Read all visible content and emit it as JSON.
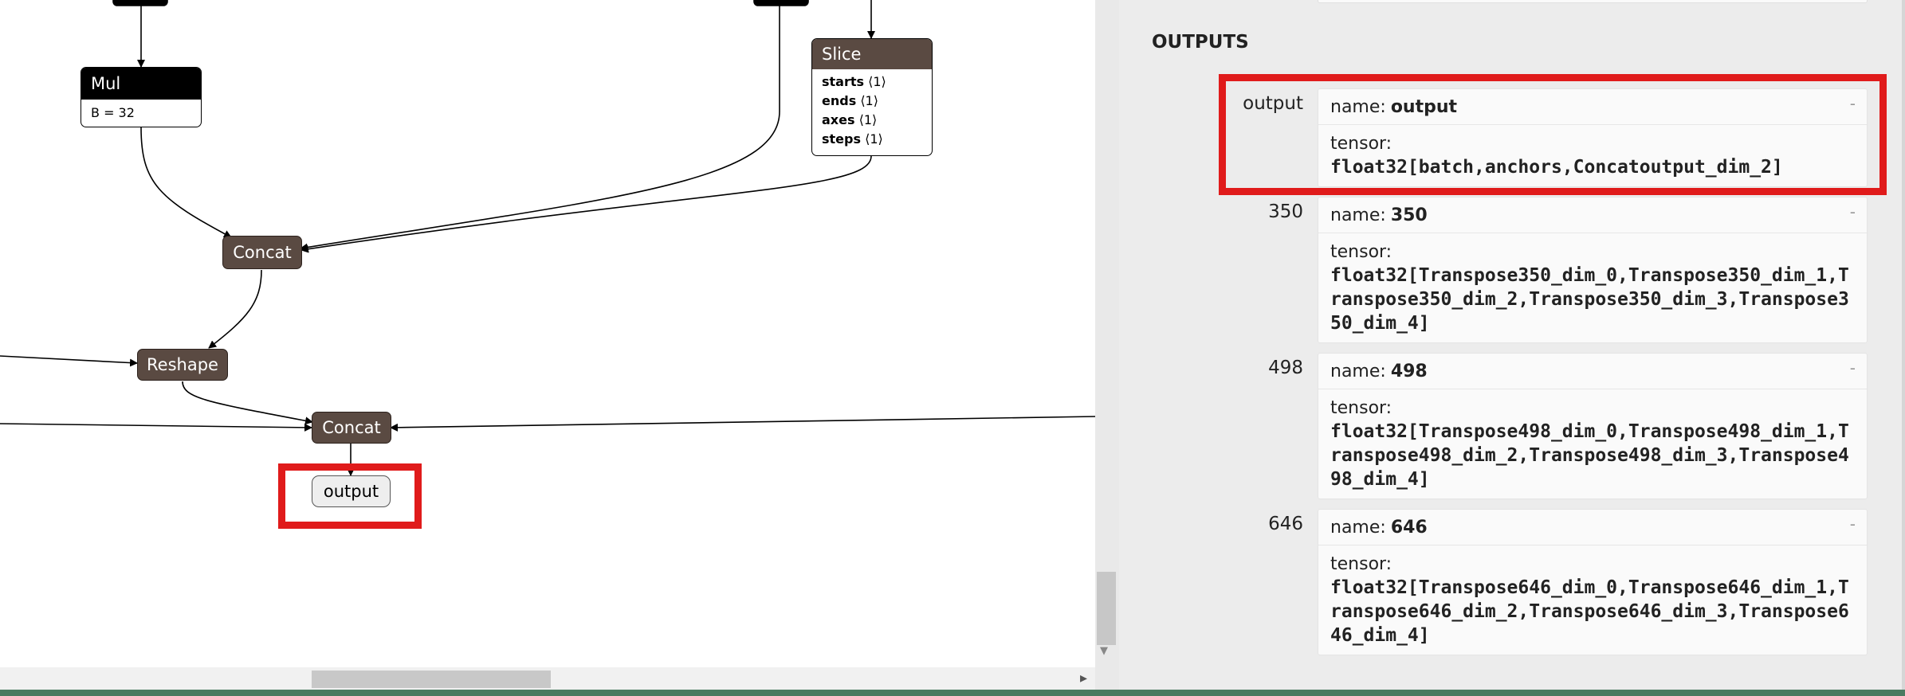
{
  "graph": {
    "nodes": {
      "mul": {
        "title": "Mul",
        "attr": "B = 32"
      },
      "slice": {
        "title": "Slice",
        "attrs": [
          {
            "key": "starts",
            "value": "⟨1⟩"
          },
          {
            "key": "ends",
            "value": "⟨1⟩"
          },
          {
            "key": "axes",
            "value": "⟨1⟩"
          },
          {
            "key": "steps",
            "value": "⟨1⟩"
          }
        ]
      },
      "concat1": "Concat",
      "reshape": "Reshape",
      "concat2": "Concat",
      "output": "output"
    }
  },
  "sidebar": {
    "section_title": "OUTPUTS",
    "outputs": [
      {
        "label": "output",
        "name_label": "name:",
        "name": "output",
        "tensor_label": "tensor:",
        "type": "float32[batch,anchors,Concatoutput_dim_2]",
        "expander": "-"
      },
      {
        "label": "350",
        "name_label": "name:",
        "name": "350",
        "tensor_label": "tensor:",
        "type": "float32[Transpose350_dim_0,Transpose350_dim_1,Transpose350_dim_2,Transpose350_dim_3,Transpose350_dim_4]",
        "expander": "-"
      },
      {
        "label": "498",
        "name_label": "name:",
        "name": "498",
        "tensor_label": "tensor:",
        "type": "float32[Transpose498_dim_0,Transpose498_dim_1,Transpose498_dim_2,Transpose498_dim_3,Transpose498_dim_4]",
        "expander": "-"
      },
      {
        "label": "646",
        "name_label": "name:",
        "name": "646",
        "tensor_label": "tensor:",
        "type": "float32[Transpose646_dim_0,Transpose646_dim_1,Transpose646_dim_2,Transpose646_dim_3,Transpose646_dim_4]",
        "expander": "-"
      }
    ]
  },
  "colors": {
    "node_fill": "#5a4a42",
    "highlight": "#e01b1b",
    "card_header": "#000000"
  },
  "scrollbars": {
    "right_arrow": "▸",
    "down_arrow": "▼"
  }
}
